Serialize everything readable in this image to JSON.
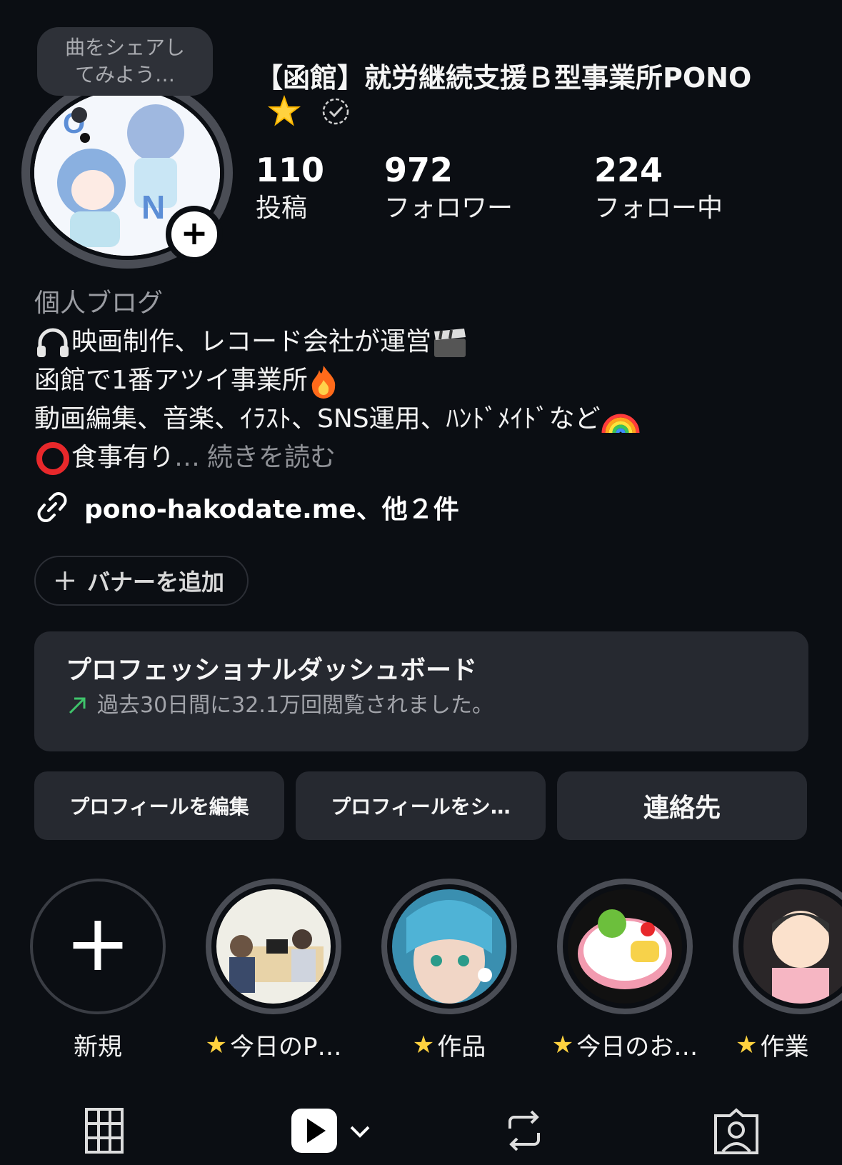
{
  "tooltip": {
    "text_line1": "曲をシェアし",
    "text_line2": "てみよう…"
  },
  "profile": {
    "name": "【函館】就労継続支援Ｂ型事業所PONO",
    "stats": [
      {
        "value": "110",
        "label": "投稿"
      },
      {
        "value": "972",
        "label": "フォロワー"
      },
      {
        "value": "224",
        "label": "フォロー中"
      }
    ]
  },
  "bio": {
    "category": "個人ブログ",
    "line1": "映画制作、レコード会社が運営",
    "line2": "函館で1番アツイ事業所",
    "line3": "動画編集、音楽、ｲﾗｽﾄ、SNS運用、ﾊﾝﾄﾞﾒｲﾄﾞなど",
    "line4": "食事有り",
    "ellipsis": "…",
    "more": "続きを読む"
  },
  "link": {
    "text": "pono-hakodate.me、他２件"
  },
  "banner_button": {
    "label": "バナーを追加"
  },
  "dashboard": {
    "title": "プロフェッショナルダッシュボード",
    "subtitle": "過去30日間に32.1万回閲覧されました。"
  },
  "buttons": {
    "edit": "プロフィールを編集",
    "share": "プロフィールをシ…",
    "contact": "連絡先"
  },
  "highlights": [
    {
      "label": "新規"
    },
    {
      "label": "今日のP…"
    },
    {
      "label": "作品"
    },
    {
      "label": "今日のお…"
    },
    {
      "label": "作業"
    }
  ],
  "colors": {
    "background": "#0b0e13",
    "card": "#262930",
    "accent_trend": "#3fc46b"
  }
}
